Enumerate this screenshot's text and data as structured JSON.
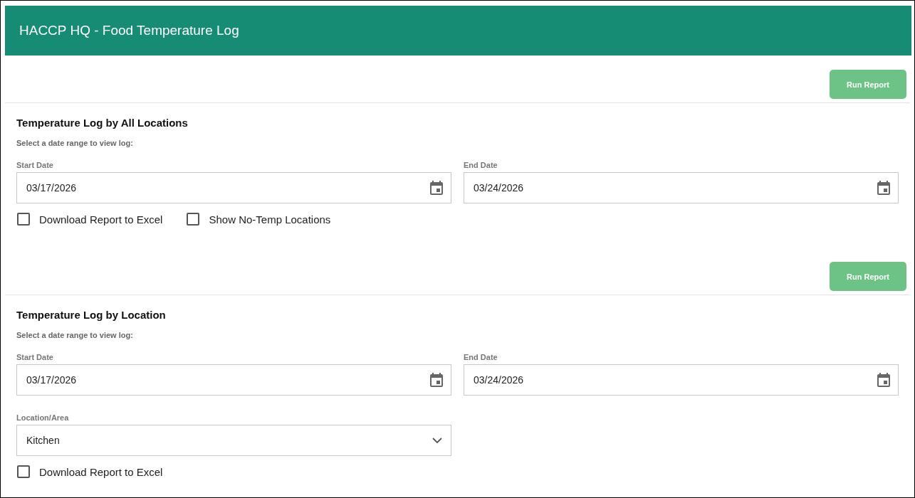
{
  "header": {
    "title": "HACCP HQ - Food Temperature Log"
  },
  "sections": [
    {
      "button": "Run Report",
      "title": "Temperature Log by All Locations",
      "hint": "Select a date range to view log:",
      "fields": [
        {
          "kind": "date",
          "label": "Start Date",
          "value": "03/17/2026"
        },
        {
          "kind": "date",
          "label": "End Date",
          "value": "03/24/2026"
        }
      ],
      "checkboxes": [
        {
          "label": "Download Report to Excel",
          "checked": false
        },
        {
          "label": "Show No-Temp Locations",
          "checked": false
        }
      ]
    },
    {
      "button": "Run Report",
      "title": "Temperature Log by Location",
      "hint": "Select a date range to view log:",
      "fields": [
        {
          "kind": "date",
          "label": "Start Date",
          "value": "03/17/2026"
        },
        {
          "kind": "date",
          "label": "End Date",
          "value": "03/24/2026"
        },
        {
          "kind": "select",
          "label": "Location/Area",
          "value": "Kitchen"
        }
      ],
      "checkboxes": [
        {
          "label": "Download Report to Excel",
          "checked": false
        }
      ]
    }
  ]
}
